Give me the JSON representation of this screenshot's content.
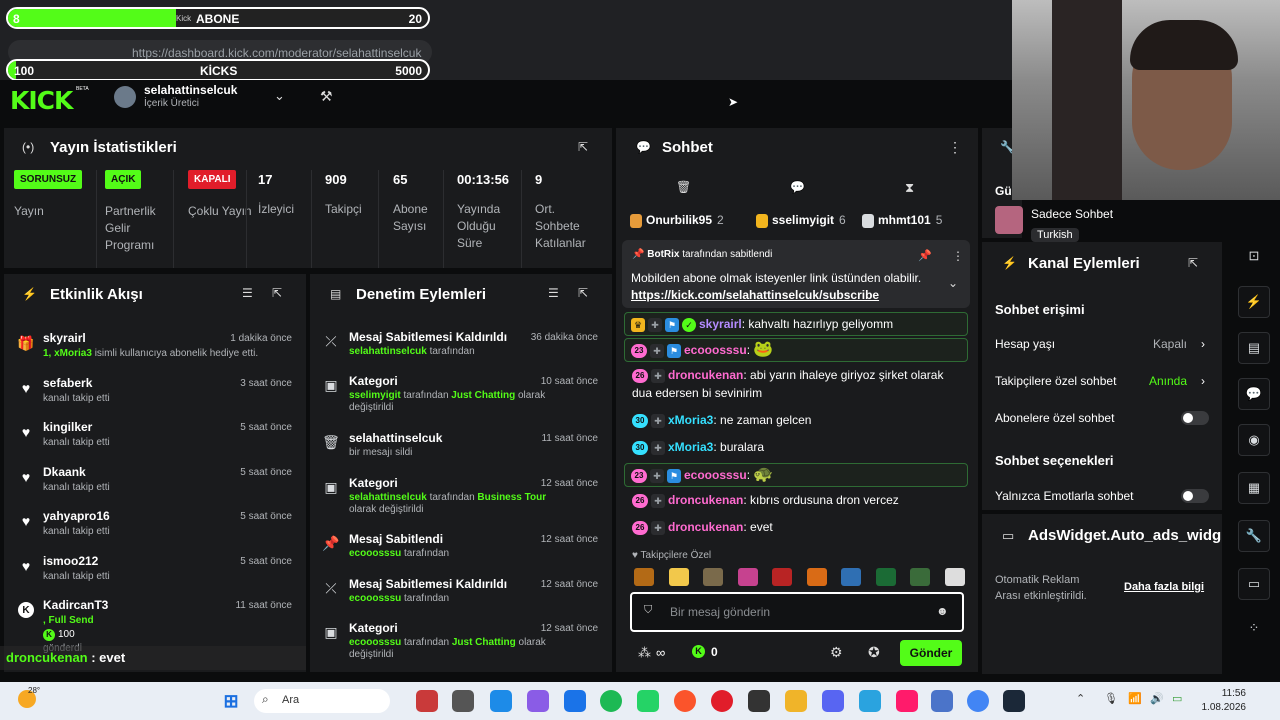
{
  "goals": {
    "subs": {
      "current": "8",
      "label": "ABONE",
      "target": "20",
      "fill_percent": 40,
      "prefix": "Kick"
    },
    "kicks": {
      "current": "100",
      "label": "KİCKS",
      "target": "5000",
      "fill_percent": 2
    }
  },
  "browser": {
    "url": "https://dashboard.kick.com/moderator/selahattinselcuk"
  },
  "header": {
    "logo": "KICK",
    "beta": "BETA",
    "username": "selahattinselcuk",
    "role": "İçerik Üretici"
  },
  "stats": {
    "title": "Yayın İstatistikleri",
    "items": [
      {
        "badge": "SORUNSUZ",
        "badge_color": "#53fc18",
        "label": "Yayın"
      },
      {
        "badge": "AÇIK",
        "badge_color": "#53fc18",
        "label": "Partnerlik Gelir Programı"
      },
      {
        "badge": "KAPALI",
        "badge_color": "#e11d2a",
        "label": "Çoklu Yayın"
      },
      {
        "value": "17",
        "label": "İzleyici"
      },
      {
        "value": "909",
        "label": "Takipçi"
      },
      {
        "value": "65",
        "label": "Abone Sayısı"
      },
      {
        "value": "00:13:56",
        "label": "Yayında Olduğu Süre"
      },
      {
        "value": "9",
        "label": "Ort. Sohbete Katılanlar"
      }
    ]
  },
  "activity": {
    "title": "Etkinlik Akışı",
    "items": [
      {
        "icon": "gift-icon",
        "name": "skyrairl",
        "time": "1 dakika önce",
        "desc_green": "1, xMoria3",
        "desc": " isimli kullanıcıya abonelik hediye etti."
      },
      {
        "icon": "heart-icon",
        "name": "sefaberk",
        "time": "3 saat önce",
        "desc": "kanalı takip etti"
      },
      {
        "icon": "heart-icon",
        "name": "kingilker",
        "time": "5 saat önce",
        "desc": "kanalı takip etti"
      },
      {
        "icon": "heart-icon",
        "name": "Dkaank",
        "time": "5 saat önce",
        "desc": "kanalı takip etti"
      },
      {
        "icon": "heart-icon",
        "name": "yahyapro16",
        "time": "5 saat önce",
        "desc": "kanalı takip etti"
      },
      {
        "icon": "heart-icon",
        "name": "ismoo212",
        "time": "5 saat önce",
        "desc": "kanalı takip etti"
      },
      {
        "icon": "kicks-icon",
        "name": "KadircanT3",
        "time": "11 saat önce",
        "desc_green": ", Full Send",
        "amount": "100",
        "desc2": "gönderdi"
      }
    ]
  },
  "overlay_chat": {
    "user": "droncukenan",
    "text": " : evet"
  },
  "moderation": {
    "title": "Denetim Eylemleri",
    "items": [
      {
        "icon": "unpin-icon",
        "title": "Mesaj Sabitlemesi Kaldırıldı",
        "time": "36 dakika önce",
        "user": "selahattinselcuk",
        "suffix": " tarafından"
      },
      {
        "icon": "category-icon",
        "title": "Kategori",
        "time": "10 saat önce",
        "user": "sselimyigit",
        "mid": " tarafından ",
        "cat": "Just Chatting",
        "suffix": " olarak değiştirildi"
      },
      {
        "icon": "trash-icon",
        "title": "selahattinselcuk",
        "time": "11 saat önce",
        "plain": "bir mesajı sildi"
      },
      {
        "icon": "category-icon",
        "title": "Kategori",
        "time": "12 saat önce",
        "user": "selahattinselcuk",
        "mid": " tarafından ",
        "cat": "Business Tour",
        "suffix": " olarak değiştirildi"
      },
      {
        "icon": "pin-icon",
        "title": "Mesaj Sabitlendi",
        "time": "12 saat önce",
        "user": "ecooosssu",
        "suffix": " tarafından"
      },
      {
        "icon": "unpin-icon",
        "title": "Mesaj Sabitlemesi Kaldırıldı",
        "time": "12 saat önce",
        "user": "ecooosssu",
        "suffix": " tarafından"
      },
      {
        "icon": "category-icon",
        "title": "Kategori",
        "time": "12 saat önce",
        "user": "ecooosssu",
        "mid": " tarafından ",
        "cat": "Just Chatting",
        "suffix": " olarak değiştirildi"
      }
    ]
  },
  "chat": {
    "title": "Sohbet",
    "top": [
      {
        "name": "Onurbilik95",
        "count": "2"
      },
      {
        "name": "sselimyigit",
        "count": "6"
      },
      {
        "name": "mhmt101",
        "count": "5"
      }
    ],
    "pinned": {
      "by": "BotRix",
      "by_suffix": "tarafından sabitlendi",
      "text": "Mobilden abone olmak isteyenler link üstünden olabilir.",
      "link": "https://kick.com/selahattinselcuk/subscribe"
    },
    "messages": [
      {
        "user": "skyrairl",
        "color": "#b48cff",
        "text": "kahvaltı hazırlıyp geliyomm",
        "hl": true
      },
      {
        "user": "ecooosssu",
        "color": "#ff6bd0",
        "level": "23",
        "text": "",
        "emote": "🐸",
        "hl": true
      },
      {
        "user": "droncukenan",
        "color": "#ff6bd0",
        "level": "26",
        "text": "abi yarın ihaleye giriyoz şirket olarak dua edersen bi sevinirim"
      },
      {
        "user": "xMoria3",
        "color": "#35e0ff",
        "level": "30",
        "text": "ne zaman gelcen"
      },
      {
        "user": "xMoria3",
        "color": "#35e0ff",
        "level": "30",
        "text": "buralara"
      },
      {
        "user": "ecooosssu",
        "color": "#ff6bd0",
        "level": "23",
        "text": "",
        "emote": "🐢",
        "hl": true
      },
      {
        "user": "droncukenan",
        "color": "#ff6bd0",
        "level": "26",
        "text": "kıbrıs ordusuna dron vercez"
      },
      {
        "user": "droncukenan",
        "color": "#ff6bd0",
        "level": "26",
        "text": "evet"
      }
    ],
    "followers_only": "Takipçilere Özel",
    "input_placeholder": "Bir mesaj gönderin",
    "send": "Gönder",
    "viewers_icon": "∞",
    "kicks_count": "0"
  },
  "right": {
    "partial": "Gü",
    "mode_label": "Sadece Sohbet",
    "lang": "Turkish",
    "actions_title": "Kanal Eylemleri",
    "access_title": "Sohbet erişimi",
    "rows": [
      {
        "label": "Hesap yaşı",
        "value": "Kapalı"
      },
      {
        "label": "Takipçilere özel sohbet",
        "value": "Anında"
      },
      {
        "label": "Abonelere özel sohbet"
      }
    ],
    "options_title": "Sohbet seçenekleri",
    "emote_only": "Yalnızca Emotlarla sohbet",
    "ads_title": "AdsWidget.Auto_ads_widg",
    "ads_text": "Otomatik Reklam Arası etkinleştirildi.",
    "ads_link": "Daha fazla bilgi"
  },
  "taskbar": {
    "temp": "28°",
    "search": "Ara",
    "time": "11:56",
    "date": "1.08.2026"
  }
}
